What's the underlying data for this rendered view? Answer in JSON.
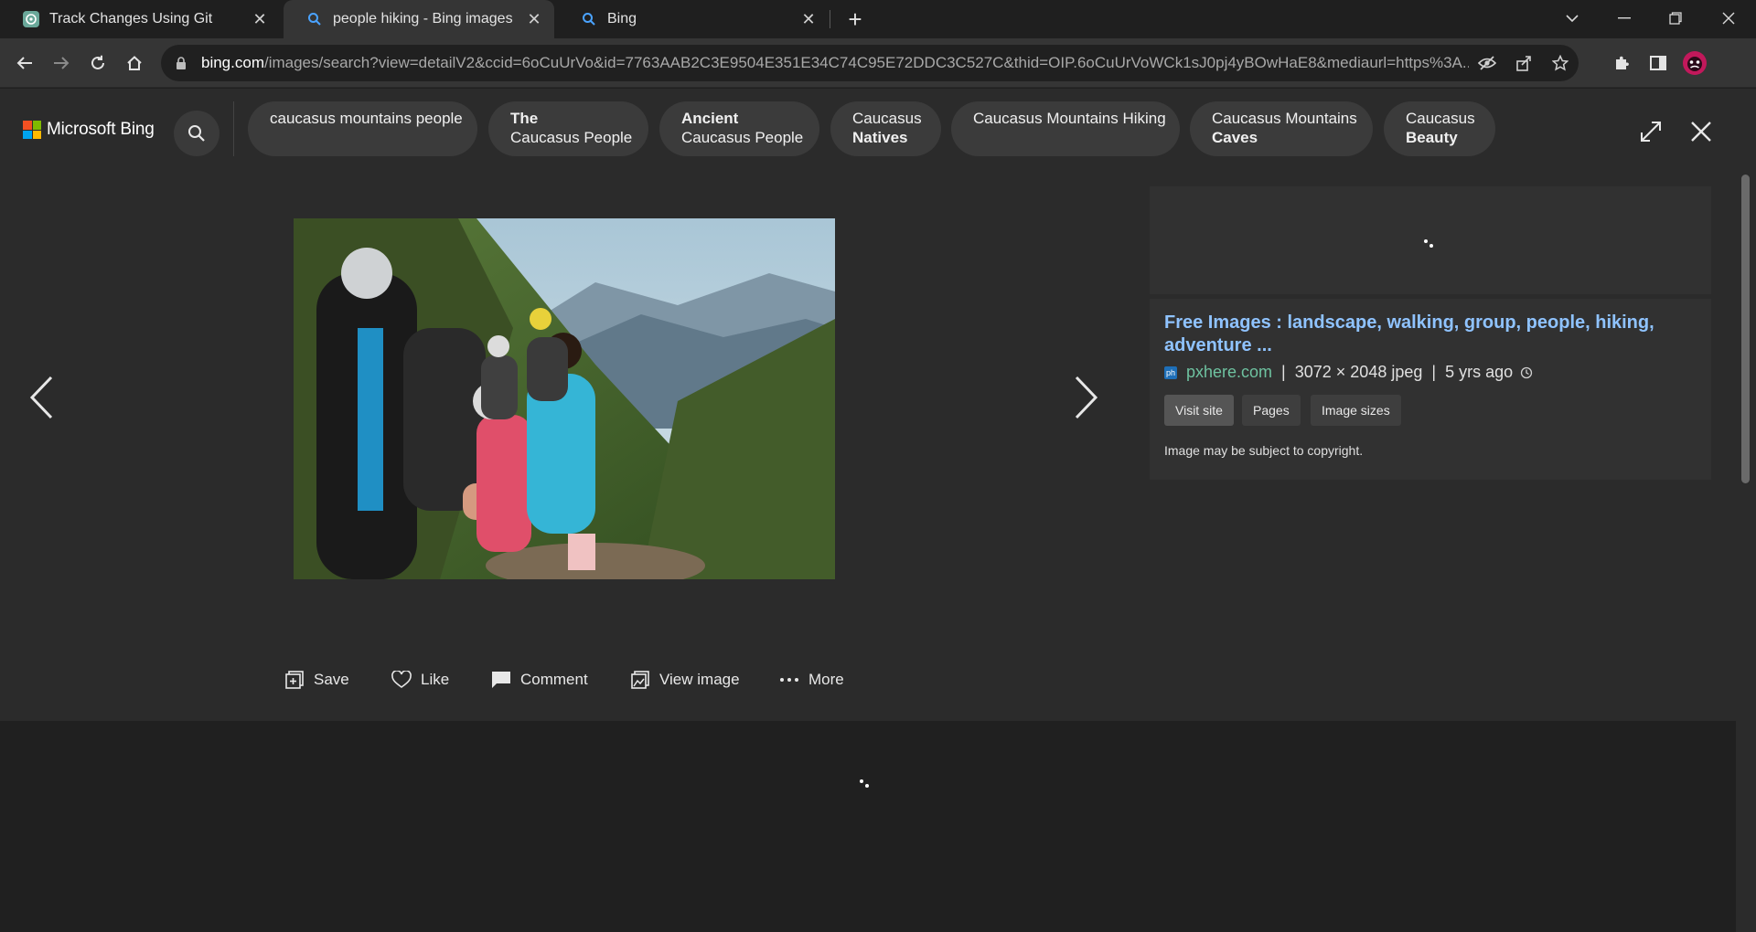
{
  "tabs": [
    {
      "title": "Track Changes Using Git",
      "icon": "chatgpt-icon",
      "active": false
    },
    {
      "title": "people hiking - Bing images",
      "icon": "search-icon",
      "active": true
    },
    {
      "title": "Bing",
      "icon": "search-icon",
      "active": false
    }
  ],
  "address_bar": {
    "host": "bing.com",
    "path": "/images/search?view=detailV2&ccid=6oCuUrVo&id=7763AAB2C3E9504E351E34C74C95E72DDC3C527C&thid=OIP.6oCuUrVoWCk1sJ0pj4yBOwHaE8&mediaurl=https%3A..."
  },
  "bing": {
    "logo_text": "Microsoft Bing",
    "brand_colors": [
      "#f25022",
      "#7fba00",
      "#00a4ef",
      "#ffb900"
    ],
    "related_searches": [
      {
        "line1": "caucasus mountains people",
        "line2": "",
        "bold_line": 0
      },
      {
        "line1": "The",
        "line2": "Caucasus People",
        "bold_line": 1
      },
      {
        "line1": "Ancient",
        "line2": "Caucasus People",
        "bold_line": 1
      },
      {
        "line1": "Caucasus",
        "line2": "Natives",
        "bold_line": 2
      },
      {
        "line1": "Caucasus Mountains Hiking",
        "line2": "",
        "bold_line": 0
      },
      {
        "line1": "Caucasus Mountains",
        "line2": "Caves",
        "bold_line": 2
      },
      {
        "line1": "Caucasus",
        "line2": "Beauty",
        "bold_line": 2
      }
    ]
  },
  "actions": {
    "save": "Save",
    "like": "Like",
    "comment": "Comment",
    "view_image": "View image",
    "more": "More"
  },
  "result": {
    "title": "Free Images : landscape, walking, group, people, hiking, adventure ...",
    "source": "pxhere.com",
    "source_badge": "ph",
    "dimensions": "3072 × 2048 jpeg",
    "age": "5 yrs ago",
    "buttons": {
      "visit": "Visit site",
      "pages": "Pages",
      "sizes": "Image sizes"
    },
    "copyright": "Image may be subject to copyright."
  },
  "accent_color": "#8fc3ff"
}
